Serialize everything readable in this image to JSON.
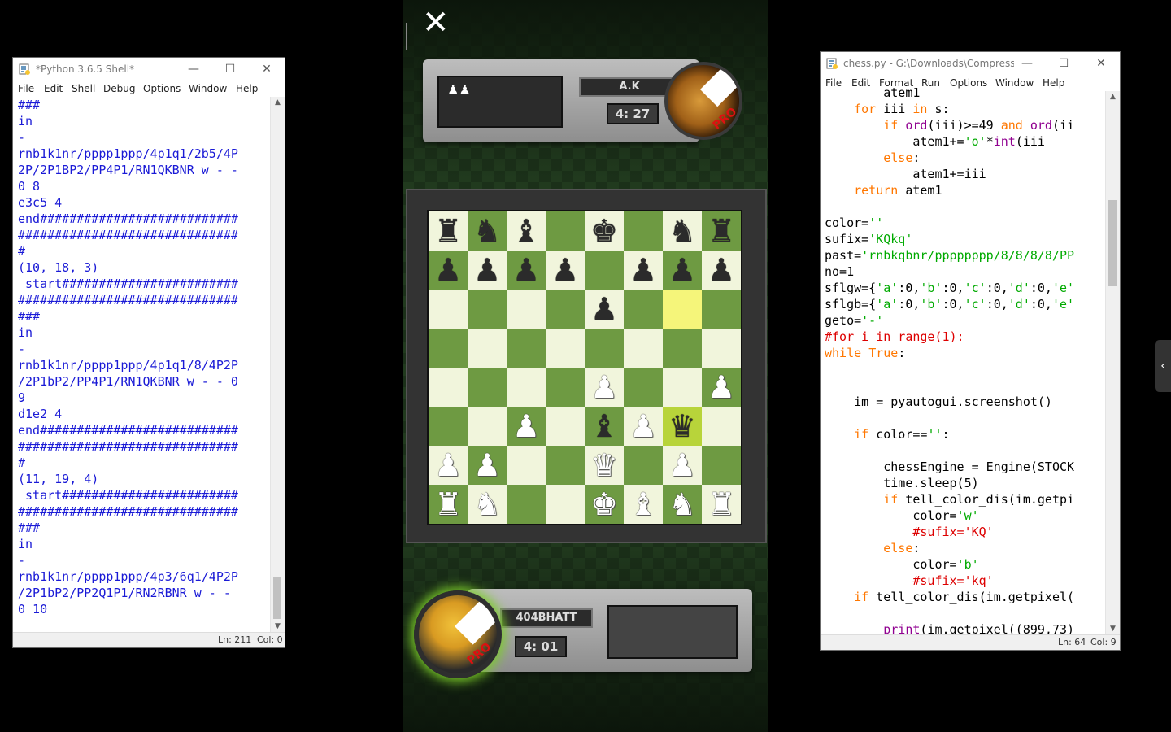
{
  "shell": {
    "title": "*Python 3.6.5 Shell*",
    "menu": [
      "File",
      "Edit",
      "Shell",
      "Debug",
      "Options",
      "Window",
      "Help"
    ],
    "lines": [
      "###",
      "in",
      "-",
      "rnb1k1nr/pppp1ppp/4p1q1/2b5/4P",
      "2P/2P1BP2/PP4P1/RN1QKBNR w - -",
      "0 8",
      "e3c5 4",
      "end###########################",
      "##############################",
      "#",
      "(10, 18, 3)",
      " start########################",
      "##############################",
      "###",
      "in",
      "-",
      "rnb1k1nr/pppp1ppp/4p1q1/8/4P2P",
      "/2P1bP2/PP4P1/RN1QKBNR w - - 0",
      "9",
      "d1e2 4",
      "end###########################",
      "##############################",
      "#",
      "(11, 19, 4)",
      " start########################",
      "##############################",
      "###",
      "in",
      "-",
      "rnb1k1nr/pppp1ppp/4p3/6q1/4P2P",
      "/2P1bP2/PP2Q1P1/RN2RBNR w - -",
      "0 10"
    ],
    "status_ln": "Ln: 211",
    "status_col": "Col: 0"
  },
  "editor": {
    "title": "chess.py - G:\\Downloads\\Compress...",
    "menu": [
      "File",
      "Edit",
      "Format",
      "Run",
      "Options",
      "Window",
      "Help"
    ],
    "lines": [
      [
        {
          "t": "        atem1",
          "c": "df"
        }
      ],
      [
        {
          "t": "    ",
          "c": "df"
        },
        {
          "t": "for",
          "c": "kw"
        },
        {
          "t": " iii ",
          "c": "df"
        },
        {
          "t": "in",
          "c": "kw"
        },
        {
          "t": " s:",
          "c": "df"
        }
      ],
      [
        {
          "t": "        ",
          "c": "df"
        },
        {
          "t": "if",
          "c": "kw"
        },
        {
          "t": " ",
          "c": "df"
        },
        {
          "t": "ord",
          "c": "bi"
        },
        {
          "t": "(iii)>=49 ",
          "c": "df"
        },
        {
          "t": "and",
          "c": "kw"
        },
        {
          "t": " ",
          "c": "df"
        },
        {
          "t": "ord",
          "c": "bi"
        },
        {
          "t": "(ii",
          "c": "df"
        }
      ],
      [
        {
          "t": "            atem1+=",
          "c": "df"
        },
        {
          "t": "'o'",
          "c": "str"
        },
        {
          "t": "*",
          "c": "df"
        },
        {
          "t": "int",
          "c": "bi"
        },
        {
          "t": "(iii",
          "c": "df"
        }
      ],
      [
        {
          "t": "        ",
          "c": "df"
        },
        {
          "t": "else",
          "c": "kw"
        },
        {
          "t": ":",
          "c": "df"
        }
      ],
      [
        {
          "t": "            atem1+=iii",
          "c": "df"
        }
      ],
      [
        {
          "t": "    ",
          "c": "df"
        },
        {
          "t": "return",
          "c": "kw"
        },
        {
          "t": " atem1",
          "c": "df"
        }
      ],
      [
        {
          "t": "",
          "c": "df"
        }
      ],
      [
        {
          "t": "color=",
          "c": "df"
        },
        {
          "t": "''",
          "c": "str"
        }
      ],
      [
        {
          "t": "sufix=",
          "c": "df"
        },
        {
          "t": "'KQkq'",
          "c": "str"
        }
      ],
      [
        {
          "t": "past=",
          "c": "df"
        },
        {
          "t": "'rnbkqbnr/pppppppp/8/8/8/8/PP",
          "c": "str"
        }
      ],
      [
        {
          "t": "no=1",
          "c": "df"
        }
      ],
      [
        {
          "t": "sflgw={",
          "c": "df"
        },
        {
          "t": "'a'",
          "c": "str"
        },
        {
          "t": ":0,",
          "c": "df"
        },
        {
          "t": "'b'",
          "c": "str"
        },
        {
          "t": ":0,",
          "c": "df"
        },
        {
          "t": "'c'",
          "c": "str"
        },
        {
          "t": ":0,",
          "c": "df"
        },
        {
          "t": "'d'",
          "c": "str"
        },
        {
          "t": ":0,",
          "c": "df"
        },
        {
          "t": "'e'",
          "c": "str"
        }
      ],
      [
        {
          "t": "sflgb={",
          "c": "df"
        },
        {
          "t": "'a'",
          "c": "str"
        },
        {
          "t": ":0,",
          "c": "df"
        },
        {
          "t": "'b'",
          "c": "str"
        },
        {
          "t": ":0,",
          "c": "df"
        },
        {
          "t": "'c'",
          "c": "str"
        },
        {
          "t": ":0,",
          "c": "df"
        },
        {
          "t": "'d'",
          "c": "str"
        },
        {
          "t": ":0,",
          "c": "df"
        },
        {
          "t": "'e'",
          "c": "str"
        }
      ],
      [
        {
          "t": "geto=",
          "c": "df"
        },
        {
          "t": "'-'",
          "c": "str"
        }
      ],
      [
        {
          "t": "#for i in range(1):",
          "c": "cm"
        }
      ],
      [
        {
          "t": "while",
          "c": "kw"
        },
        {
          "t": " ",
          "c": "df"
        },
        {
          "t": "True",
          "c": "kw"
        },
        {
          "t": ":",
          "c": "df"
        }
      ],
      [
        {
          "t": "",
          "c": "df"
        }
      ],
      [
        {
          "t": "",
          "c": "df"
        }
      ],
      [
        {
          "t": "    im = pyautogui.screenshot()",
          "c": "df"
        }
      ],
      [
        {
          "t": "",
          "c": "df"
        }
      ],
      [
        {
          "t": "    ",
          "c": "df"
        },
        {
          "t": "if",
          "c": "kw"
        },
        {
          "t": " color==",
          "c": "df"
        },
        {
          "t": "''",
          "c": "str"
        },
        {
          "t": ":",
          "c": "df"
        }
      ],
      [
        {
          "t": "",
          "c": "df"
        }
      ],
      [
        {
          "t": "        chessEngine = Engine(STOCK",
          "c": "df"
        }
      ],
      [
        {
          "t": "        time.sleep(5)",
          "c": "df"
        }
      ],
      [
        {
          "t": "        ",
          "c": "df"
        },
        {
          "t": "if",
          "c": "kw"
        },
        {
          "t": " tell_color_dis(im.getpi",
          "c": "df"
        }
      ],
      [
        {
          "t": "            color=",
          "c": "df"
        },
        {
          "t": "'w'",
          "c": "str"
        }
      ],
      [
        {
          "t": "            #sufix='KQ'",
          "c": "cm"
        }
      ],
      [
        {
          "t": "        ",
          "c": "df"
        },
        {
          "t": "else",
          "c": "kw"
        },
        {
          "t": ":",
          "c": "df"
        }
      ],
      [
        {
          "t": "            color=",
          "c": "df"
        },
        {
          "t": "'b'",
          "c": "str"
        }
      ],
      [
        {
          "t": "            #sufix='kq'",
          "c": "cm"
        }
      ],
      [
        {
          "t": "    ",
          "c": "df"
        },
        {
          "t": "if",
          "c": "kw"
        },
        {
          "t": " tell_color_dis(im.getpixel(",
          "c": "df"
        }
      ],
      [
        {
          "t": "",
          "c": "df"
        }
      ],
      [
        {
          "t": "        ",
          "c": "df"
        },
        {
          "t": "print",
          "c": "bi"
        },
        {
          "t": "(im.getpixel((899,73)",
          "c": "df"
        }
      ]
    ],
    "status_ln": "Ln: 64",
    "status_col": "Col: 9"
  },
  "game": {
    "close_glyph": "✕",
    "opponent": {
      "name": "A.K",
      "time": "4: 27",
      "badge": "PRO",
      "captured": "♟♟"
    },
    "player": {
      "name": "404BHATT",
      "time": "4: 01",
      "badge": "PRO"
    },
    "board": [
      [
        "r",
        "n",
        "b",
        "",
        "k",
        "",
        "n",
        "r"
      ],
      [
        "p",
        "p",
        "p",
        "p",
        "",
        "p",
        "p",
        "p"
      ],
      [
        "",
        "",
        "",
        "",
        "p",
        "",
        "",
        ""
      ],
      [
        "",
        "",
        "",
        "",
        "",
        "",
        "",
        ""
      ],
      [
        "",
        "",
        "",
        "",
        "P",
        "",
        "",
        "P"
      ],
      [
        "",
        "",
        "P",
        "",
        "b",
        "P",
        "q",
        ""
      ],
      [
        "P",
        "P",
        "",
        "",
        "Q",
        "",
        "P",
        ""
      ],
      [
        "R",
        "N",
        "",
        "",
        "K",
        "B",
        "N",
        "R"
      ]
    ],
    "highlight_from": "g6",
    "highlight_to": "g3"
  },
  "side_tab": "‹"
}
